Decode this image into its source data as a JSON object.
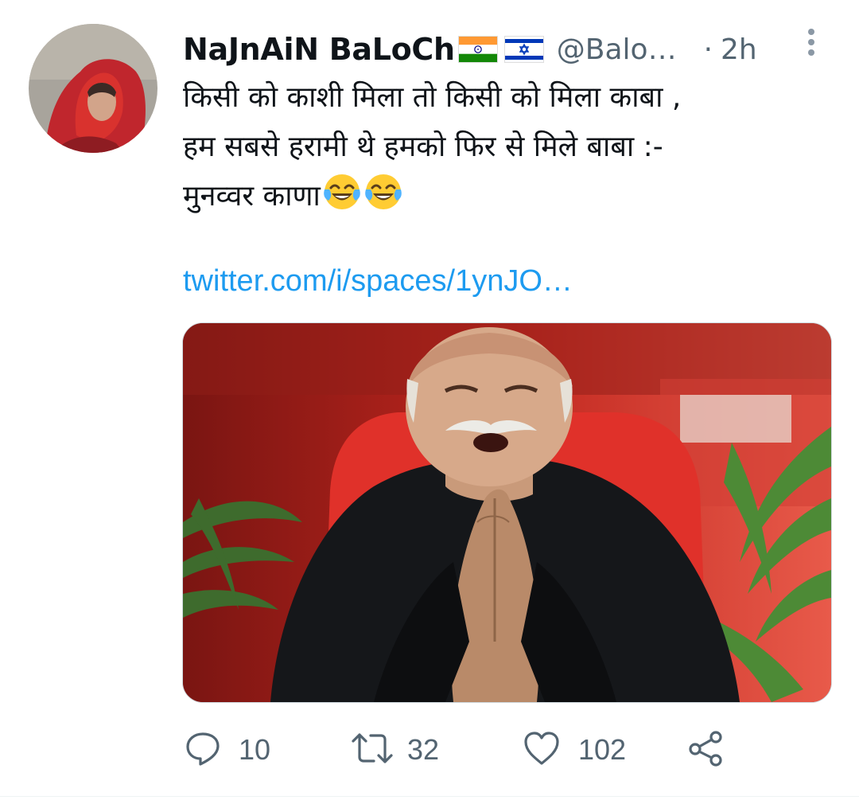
{
  "tweet": {
    "display_name": "NaJnAiN BaLoCh",
    "handle": "@Balo…",
    "separator": "·",
    "time": "2h",
    "text_lines": [
      "किसी को काशी मिला तो किसी को मिला काबा ,",
      "हम सबसे हरामी थे हमको फिर से मिले बाबा :-",
      "मुनव्वर काणा"
    ],
    "emoji_names": [
      "face-with-tears-of-joy-icon",
      "face-with-tears-of-joy-icon"
    ],
    "link": "twitter.com/i/spaces/1ynJO…",
    "flags": [
      "india-flag-icon",
      "israel-flag-icon"
    ]
  },
  "actions": {
    "reply_count": "10",
    "retweet_count": "32",
    "like_count": "102"
  },
  "colors": {
    "link": "#1d9bf0",
    "secondary_text": "#536471",
    "primary_text": "#0f1419"
  }
}
